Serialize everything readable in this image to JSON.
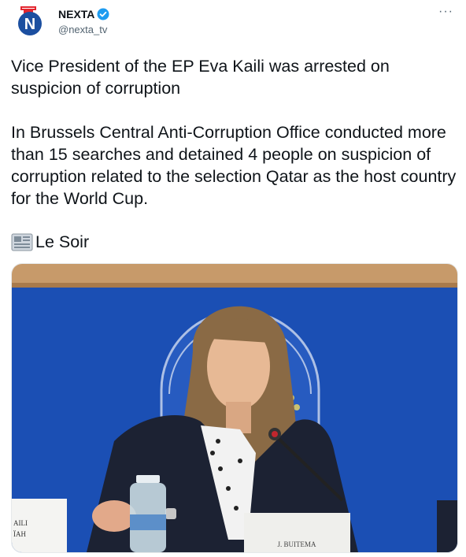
{
  "author": {
    "name": "NEXTA",
    "handle": "@nexta_tv",
    "avatar_icon": "nexta-logo-icon",
    "verified_icon": "verified-badge-icon"
  },
  "more_button": "···",
  "tweet": {
    "text": "Vice President of the EP Eva Kaili was arrested on suspicion of corruption\n\nIn Brussels Central Anti-Corruption Office conducted more than 15 searches and detained 4 people on suspicion of corruption related to the selection Qatar as the host country for the World Cup.",
    "source_icon": "newspaper-icon",
    "source_label": "Le Soir"
  },
  "photo": {
    "nameplate_left": "AILI\nÏAH",
    "nameplate_right": "J. BUITEMA"
  },
  "colors": {
    "accent": "#1d9bf0",
    "nexta_red": "#e3262f",
    "nexta_blue": "#1b4fa0",
    "photo_blue": "#1b4fb4"
  }
}
